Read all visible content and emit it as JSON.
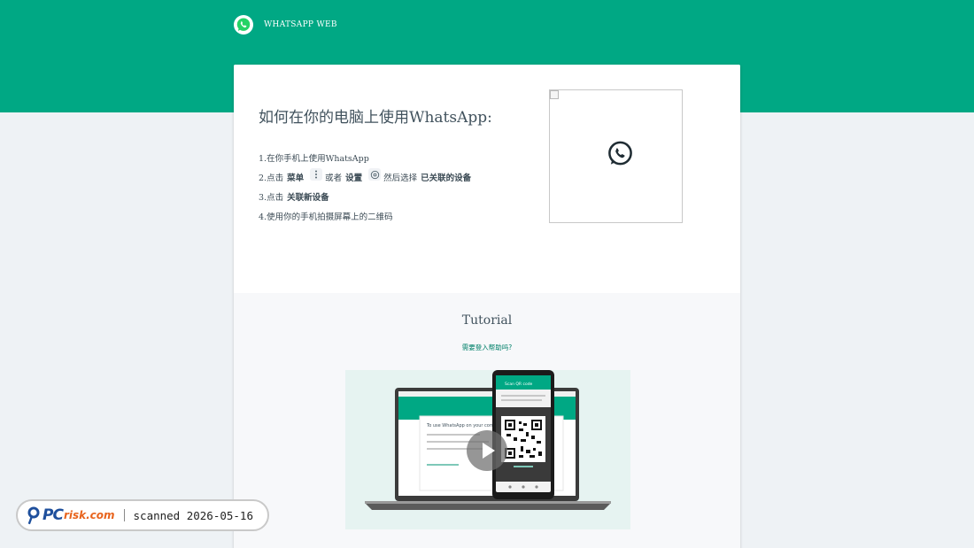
{
  "header": {
    "brand_name": "WHATSAPP WEB",
    "logo_icon": "whatsapp-logo-icon"
  },
  "intro": {
    "title": "如何在你的电脑上使用WhatsApp:",
    "steps": {
      "s1": "1.在你手机上使用WhatsApp",
      "s2_prefix": "2.点击",
      "s2_menu": "菜单",
      "s2_or": "或者",
      "s2_settings": "设置",
      "s2_then": "然后选择",
      "s2_linked": "已关联的设备",
      "s3_prefix": "3.点击",
      "s3_link": "关联新设备",
      "s4": "4.使用你的手机拍摄屏幕上的二维码"
    }
  },
  "tutorial": {
    "title": "Tutorial",
    "help_link": "需要登入帮助吗?",
    "video": {
      "laptop_heading": "To use WhatsApp on your computer:",
      "phone_header": "Scan QR code",
      "play_icon": "play-icon"
    }
  },
  "watermark": {
    "brand_pc": "PC",
    "brand_risk": "risk.com",
    "scanned": "scanned 2026-05-16"
  },
  "colors": {
    "header_green": "#00a884",
    "teal_link": "#008069",
    "page_bg": "#eef2f5"
  }
}
